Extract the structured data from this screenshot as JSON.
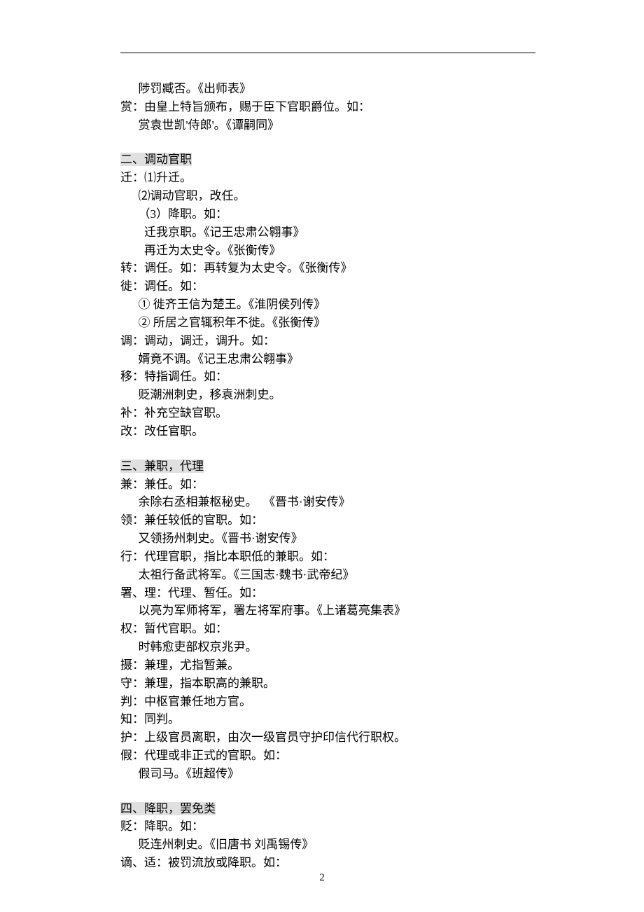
{
  "top": {
    "line1": "      陟罚臧否。《出师表》",
    "line2": "赏：由皇上特旨颁布，赐于臣下官职爵位。如：",
    "line3": "      赏袁世凯'侍郎'。《谭嗣同》"
  },
  "section2": {
    "heading": "二、调动官职",
    "lines": [
      "迁：⑴升迁。",
      "      ⑵调动官职，改任。",
      "      （3）降职。如：",
      "        迁我京职。《记王忠肃公翱事》",
      "        再迁为太史令。《张衡传》",
      "转：调任。如：再转复为太史令。《张衡传》",
      "徙：调任。如：",
      "      ① 徙齐王信为楚王。《淮阴侯列传》",
      "      ② 所居之官辄积年不徙。《张衡传》",
      "调：调动，调迁，调升。如：",
      "      婿竟不调。《记王忠肃公翱事》",
      "移：特指调任。如：",
      "      贬潮洲刺史，移袁洲刺史。",
      "补：补充空缺官职。",
      "改：改任官职。"
    ]
  },
  "section3": {
    "heading": "三、兼职，代理",
    "lines": [
      "兼：兼任。如：",
      "      余除右丞相兼枢秘史。  《晋书·谢安传》",
      "领：兼任较低的官职。如：",
      "      又领扬州刺史。《晋书·谢安传》",
      "行：代理官职，指比本职低的兼职。如：",
      "      太祖行备武将军。《三国志·魏书·武帝纪》",
      "署、理：代理、暂任。如：",
      "      以亮为军师将军，署左将军府事。《上诸葛亮集表》",
      "权：暂代官职。如：",
      "      时韩愈吏部权京兆尹。",
      "摄：兼理，尤指暂兼。",
      "守：兼理，指本职高的兼职。",
      "判：中枢官兼任地方官。",
      "知：同判。",
      "护：上级官员离职，由次一级官员守护印信代行职权。",
      "假：代理或非正式的官职。如：",
      "      假司马。《班超传》"
    ]
  },
  "section4": {
    "heading": "四、降职，罢免类",
    "lines": [
      "贬：降职。如：",
      "      贬连州刺史。《旧唐书 刘禹锡传》",
      "谪、适：被罚流放或降职。如："
    ]
  },
  "pageNumber": "2"
}
